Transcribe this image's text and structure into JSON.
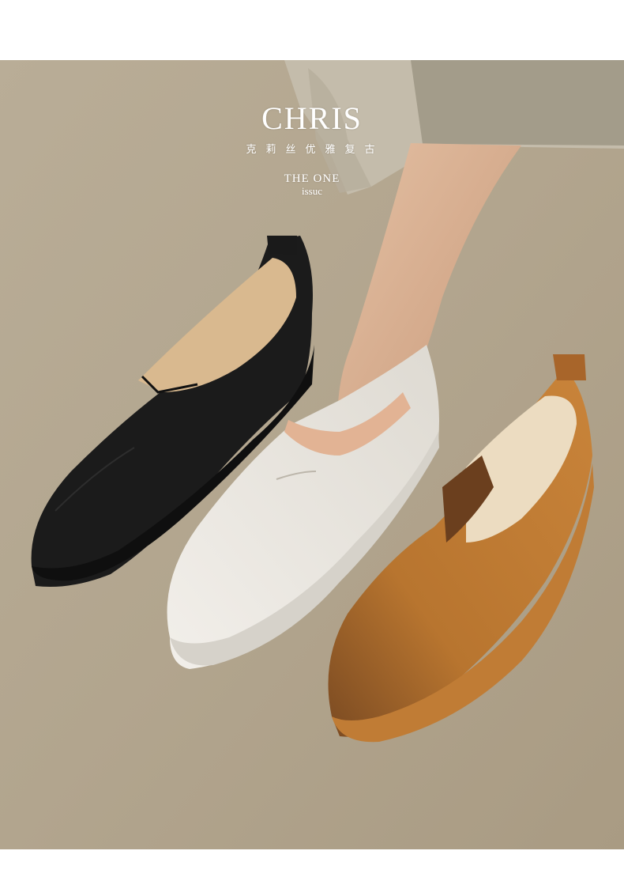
{
  "brand": {
    "name": "CHRIS",
    "tagline": "克莉丝优雅复古"
  },
  "issue": {
    "line1": "THE ONE",
    "line2": "issuc"
  },
  "colors": {
    "background": "#b3a68f",
    "shoe_black": "#1b1b1b",
    "shoe_white": "#ece9e3",
    "shoe_tan": "#b8752f",
    "trousers": "#a39c8a"
  }
}
